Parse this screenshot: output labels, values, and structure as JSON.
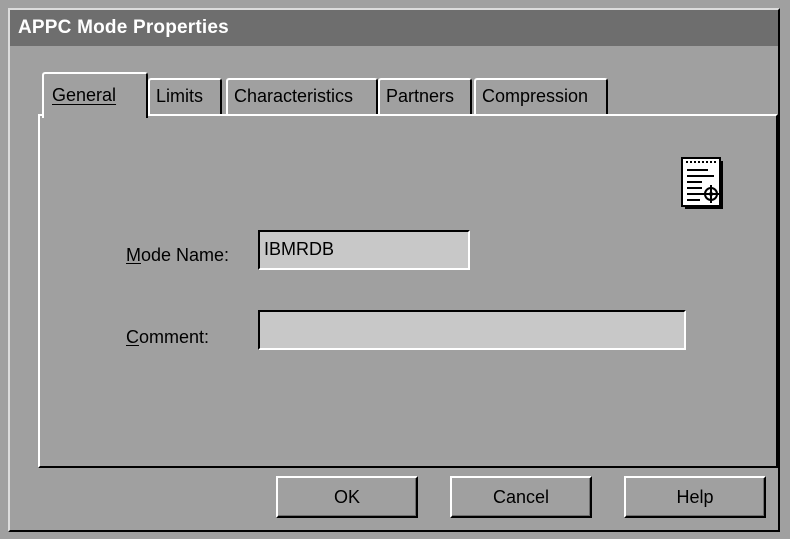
{
  "window": {
    "title": "APPC Mode Properties"
  },
  "tabs": [
    {
      "label": "General",
      "active": true
    },
    {
      "label": "Limits",
      "active": false
    },
    {
      "label": "Characteristics",
      "active": false
    },
    {
      "label": "Partners",
      "active": false
    },
    {
      "label": "Compression",
      "active": false
    }
  ],
  "form": {
    "mode_name_label_underline": "M",
    "mode_name_label_rest": "ode Name:",
    "mode_name_value": "IBMRDB",
    "comment_label_underline": "C",
    "comment_label_rest": "omment:",
    "comment_value": ""
  },
  "panel_icon": {
    "icon": "document-properties-icon"
  },
  "buttons": {
    "ok": "OK",
    "cancel": "Cancel",
    "help": "Help"
  },
  "colors": {
    "face": "#a0a0a0",
    "titlebar": "#6e6e6e",
    "field": "#c8c8c8"
  }
}
